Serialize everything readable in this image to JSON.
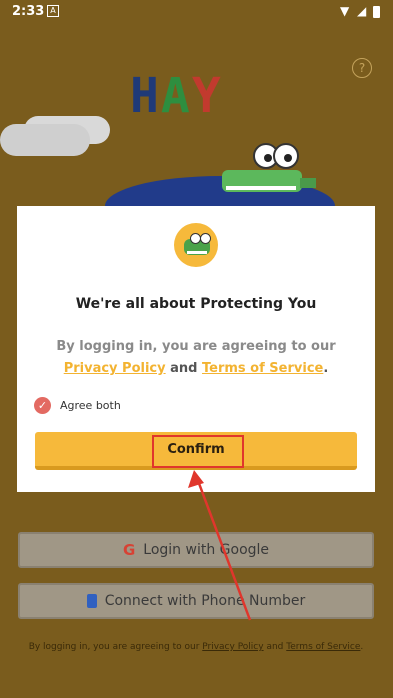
{
  "status_bar": {
    "time": "2:33",
    "notif_letter": "A"
  },
  "logo": {
    "letters": [
      "H",
      "A",
      "Y"
    ]
  },
  "help_glyph": "?",
  "dialog": {
    "title": "We're all about Protecting You",
    "text_before": "By logging in, you are agreeing to our ",
    "privacy_link": "Privacy Policy",
    "and": " and ",
    "terms_link": "Terms of Service",
    "period": ".",
    "agree_label": "Agree both",
    "confirm_label": "Confirm"
  },
  "background": {
    "google_button": "Login with Google",
    "phone_button": "Connect with Phone Number",
    "terms_prefix": "By logging in, you are agreeing to our ",
    "terms_privacy": "Privacy Policy",
    "terms_and": " and ",
    "terms_terms": "Terms of Service",
    "terms_period": "."
  },
  "colors": {
    "background": "#7a5c1d",
    "accent": "#f6b93b",
    "highlight": "#e0362c"
  }
}
